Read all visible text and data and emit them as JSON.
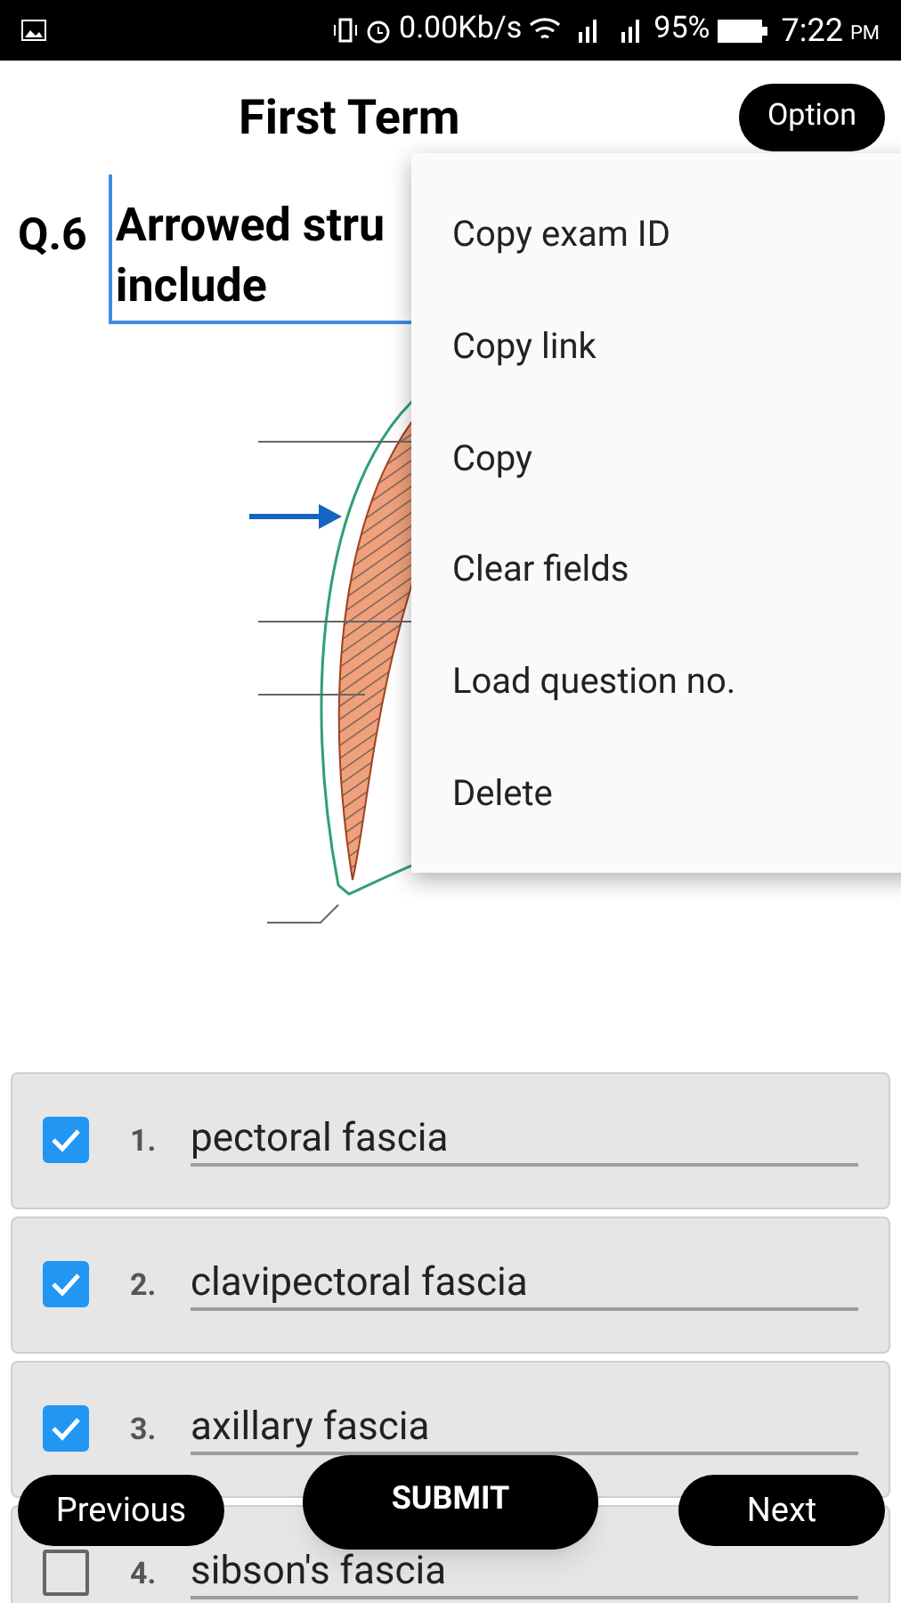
{
  "status_bar": {
    "speed": "0.00Kb/s",
    "battery": "95%",
    "time": "7:22",
    "ampm": "PM"
  },
  "header": {
    "title": "First Term",
    "option_button": "Option"
  },
  "question": {
    "number": "Q.6",
    "lines": [
      "Arrowed stru",
      "include"
    ]
  },
  "menu": {
    "items": [
      "Copy exam ID",
      "Copy link",
      "Copy",
      "Clear fields",
      "Load question no.",
      "Delete"
    ]
  },
  "options": [
    {
      "number": "1.",
      "text": "pectoral fascia",
      "checked": true
    },
    {
      "number": "2.",
      "text": "clavipectoral fascia",
      "checked": true
    },
    {
      "number": "3.",
      "text": "axillary fascia",
      "checked": true
    },
    {
      "number": "4.",
      "text": "sibson's fascia",
      "checked": false
    }
  ],
  "buttons": {
    "previous": "Previous",
    "submit": "SUBMIT",
    "next": "Next"
  }
}
